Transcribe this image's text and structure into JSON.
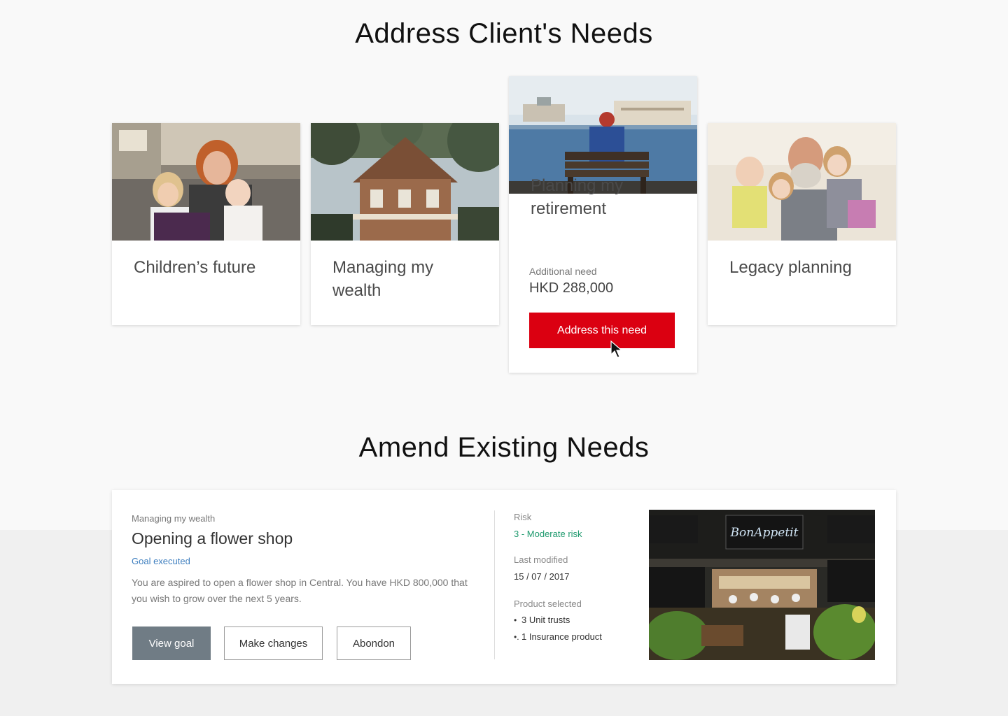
{
  "sections": {
    "address_title": "Address Client's Needs",
    "amend_title": "Amend Existing Needs"
  },
  "needs": [
    {
      "title": "Children’s future"
    },
    {
      "title": "Managing my wealth"
    },
    {
      "title": "Planning my retirement",
      "additional_label": "Additional need",
      "additional_value": "HKD 288,000",
      "button_label": "Address this need"
    },
    {
      "title": "Legacy planning"
    }
  ],
  "existing_need": {
    "category": "Managing my wealth",
    "title": "Opening a flower shop",
    "status": "Goal executed",
    "description": "You are aspired to open a flower shop in Central. You have HKD 800,000 that you wish to grow over the next 5 years.",
    "buttons": {
      "view": "View goal",
      "make_changes": "Make changes",
      "abandon": "Abondon"
    },
    "risk_label": "Risk",
    "risk_value": "3 - Moderate risk",
    "last_modified_label": "Last modified",
    "last_modified_value": "15 / 07 / 2017",
    "product_label": "Product selected",
    "products": [
      {
        "bullet": "•",
        "text": "3 Unit trusts"
      },
      {
        "bullet": "•.",
        "text": "1 Insurance product"
      }
    ],
    "photo_sign": "BonAppetit"
  },
  "colors": {
    "accent_red": "#db0011",
    "risk_green": "#1f9a6e",
    "link_blue": "#3f7fbf",
    "primary_button": "#707c85"
  }
}
